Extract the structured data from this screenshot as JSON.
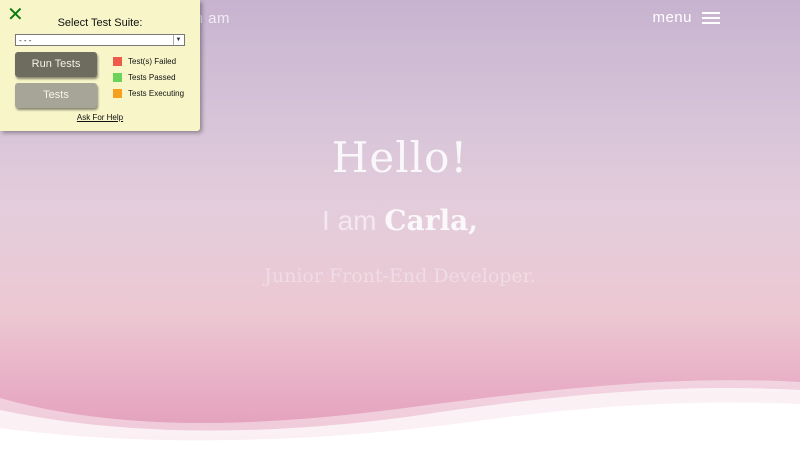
{
  "site": {
    "brand": "carla.fr.com am",
    "menu_label": "menu",
    "menu_icon": "hamburger-icon"
  },
  "hero": {
    "greeting": "Hello!",
    "intro_prefix": "I am",
    "name": "Carla,",
    "role": "Junior Front-End Developer."
  },
  "test_panel": {
    "close_icon": "close-icon",
    "suite_label": "Select Test Suite:",
    "suite_selected": "- - -",
    "run_button": "Run Tests",
    "tests_button": "Tests",
    "legend": [
      {
        "label": "Test(s) Failed",
        "color": "#f05a4a"
      },
      {
        "label": "Tests Passed",
        "color": "#6cd35a"
      },
      {
        "label": "Tests Executing",
        "color": "#f5a01e"
      }
    ],
    "help_link": "Ask For Help"
  },
  "colors": {
    "panel_bg": "#f8f6c9",
    "close_green": "#0c7a0c",
    "run_button_bg": "#6e6c5e",
    "tests_button_bg": "#a7a597"
  }
}
